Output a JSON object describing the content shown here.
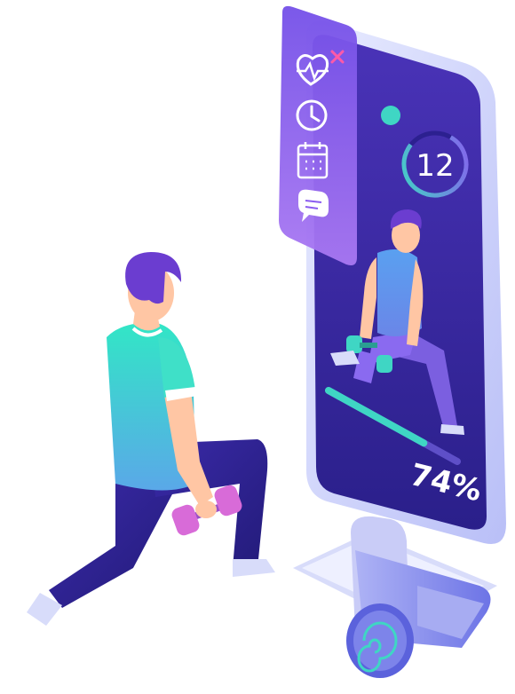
{
  "screen": {
    "rep_counter": "12",
    "progress_percent_label": "74%",
    "progress_value": 0.74
  },
  "side_menu": {
    "items": [
      {
        "icon": "heart-rate-icon"
      },
      {
        "icon": "clock-icon"
      },
      {
        "icon": "calendar-icon"
      },
      {
        "icon": "chat-icon"
      }
    ],
    "close_icon": "close-icon"
  },
  "colors": {
    "screen_bg": "#3b2a9e",
    "panel_bg": "#8a5cf0",
    "progress_fill": "#3fd6c4",
    "shirt_gradient": [
      "#3fe0c8",
      "#7a6bff"
    ],
    "mat": "#8f95f0"
  }
}
